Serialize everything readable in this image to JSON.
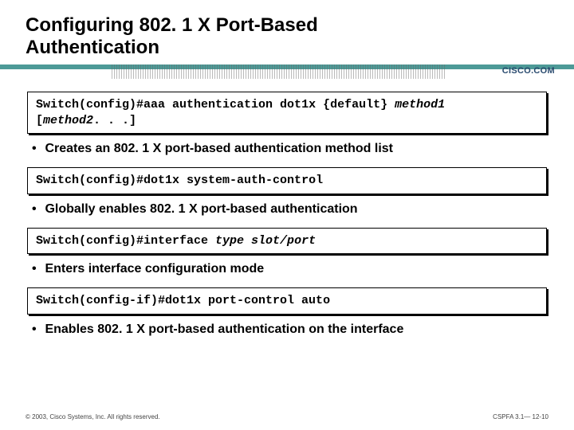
{
  "title_line1": "Configuring 802. 1 X Port-Based",
  "title_line2": "Authentication",
  "logo_text": "CISCO.COM",
  "cmd1": {
    "prompt": "Switch(config)#",
    "kw": "aaa authentication dot1x ",
    "brace": "{default}",
    "m1": " method1",
    "m2_open": "[",
    "m2": "method2",
    "m2_rest": ". . .]"
  },
  "bullet1": "Creates an 802. 1 X port-based authentication method list",
  "cmd2": {
    "prompt": "Switch(config)#",
    "kw": "dot1x system-auth-control"
  },
  "bullet2": "Globally enables 802. 1 X port-based authentication",
  "cmd3": {
    "prompt": "Switch(config)#",
    "kw": "interface ",
    "arg": "type slot/port"
  },
  "bullet3": "Enters interface configuration mode",
  "cmd4": {
    "prompt": "Switch(config-if)#",
    "kw": "dot1x port-control auto"
  },
  "bullet4": "Enables 802. 1 X port-based authentication on the interface",
  "footer_left": "© 2003, Cisco Systems, Inc. All rights reserved.",
  "footer_right": "CSPFA 3.1— 12-10"
}
